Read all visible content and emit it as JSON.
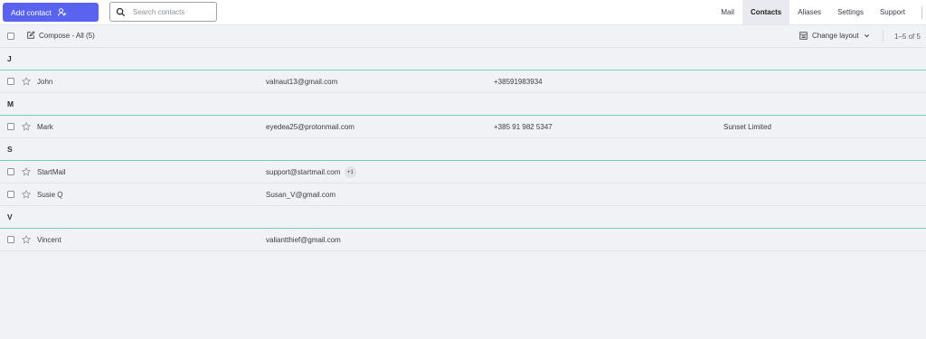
{
  "toolbar_top": {
    "add_contact_label": "Add contact",
    "search_placeholder": "Search contacts"
  },
  "nav": {
    "items": [
      {
        "label": "Mail",
        "active": false
      },
      {
        "label": "Contacts",
        "active": true
      },
      {
        "label": "Aliases",
        "active": false
      },
      {
        "label": "Settings",
        "active": false
      },
      {
        "label": "Support",
        "active": false
      }
    ]
  },
  "list_toolbar": {
    "compose_label": "Compose - All (5)",
    "change_layout_label": "Change layout",
    "range_label": "1–5 of 5"
  },
  "groups": [
    {
      "letter": "J",
      "contacts": [
        {
          "name": "John",
          "email": "valnaut13@gmail.com",
          "phone": "+38591983934",
          "company": ""
        }
      ]
    },
    {
      "letter": "M",
      "contacts": [
        {
          "name": "Mark",
          "email": "eyedea25@protonmail.com",
          "phone": "+385 91 982 5347",
          "company": "Sunset Limited"
        }
      ]
    },
    {
      "letter": "S",
      "contacts": [
        {
          "name": "StartMail",
          "email": "support@startmail.com",
          "badge": "+1",
          "phone": "",
          "company": ""
        },
        {
          "name": "Susie Q",
          "email": "Susan_V@gmail.com",
          "phone": "",
          "company": ""
        }
      ]
    },
    {
      "letter": "V",
      "contacts": [
        {
          "name": "Vincent",
          "email": "valiantthief@gmail.com",
          "phone": "",
          "company": ""
        }
      ]
    }
  ],
  "colors": {
    "accent": "#5a63f0",
    "group_divider": "#6fd3b9",
    "background": "#f1f2f6"
  }
}
